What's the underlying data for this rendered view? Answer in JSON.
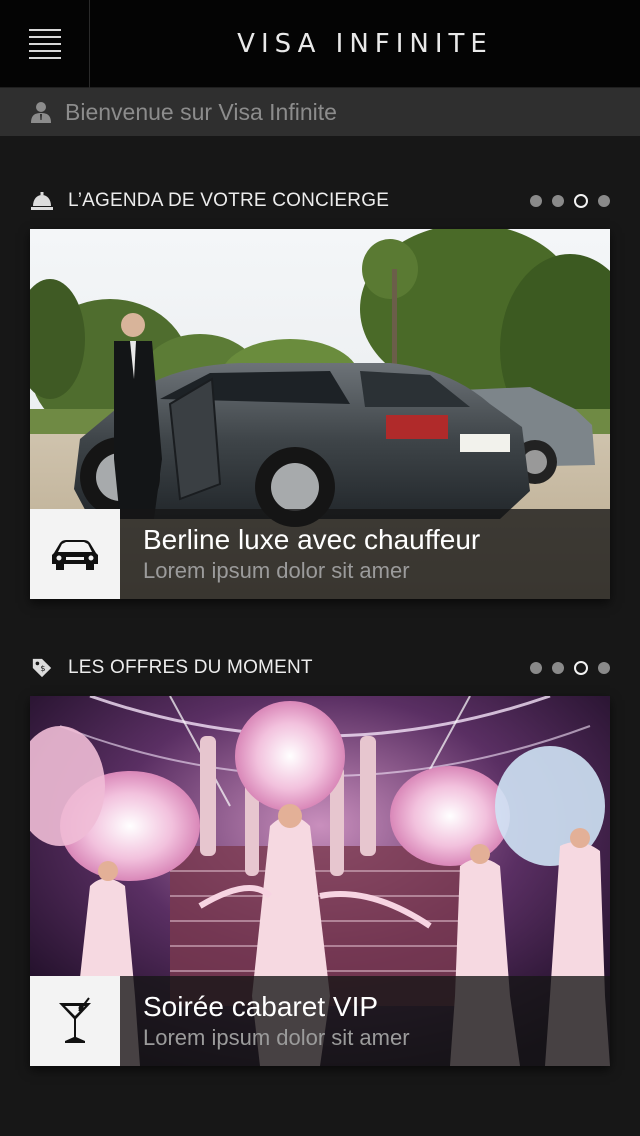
{
  "header": {
    "menu_icon": "hamburger-menu-icon",
    "logo_text": "VISA INFINITE"
  },
  "welcome": {
    "icon": "user-icon",
    "text": "Bienvenue  sur Visa Infinite"
  },
  "sections": [
    {
      "icon": "concierge-bell-icon",
      "title": "L’AGENDA DE VOTRE CONCIERGE",
      "carousel": {
        "pages": 4,
        "active": 3
      },
      "card": {
        "icon": "car-icon",
        "title": "Berline luxe avec chauffeur",
        "subtitle": "Lorem ipsum dolor sit amer"
      }
    },
    {
      "icon": "price-tag-icon",
      "title": "LES OFFRES DU MOMENT",
      "carousel": {
        "pages": 4,
        "active": 3
      },
      "card": {
        "icon": "cocktail-glass-icon",
        "title": "Soirée cabaret VIP",
        "subtitle": "Lorem ipsum dolor sit amer"
      }
    }
  ],
  "colors": {
    "background": "#171717",
    "topbar": "#040404",
    "welcome_bar": "#2f2f2f",
    "caption_bar": "#161616",
    "icon_tile": "#f3f3f3"
  }
}
